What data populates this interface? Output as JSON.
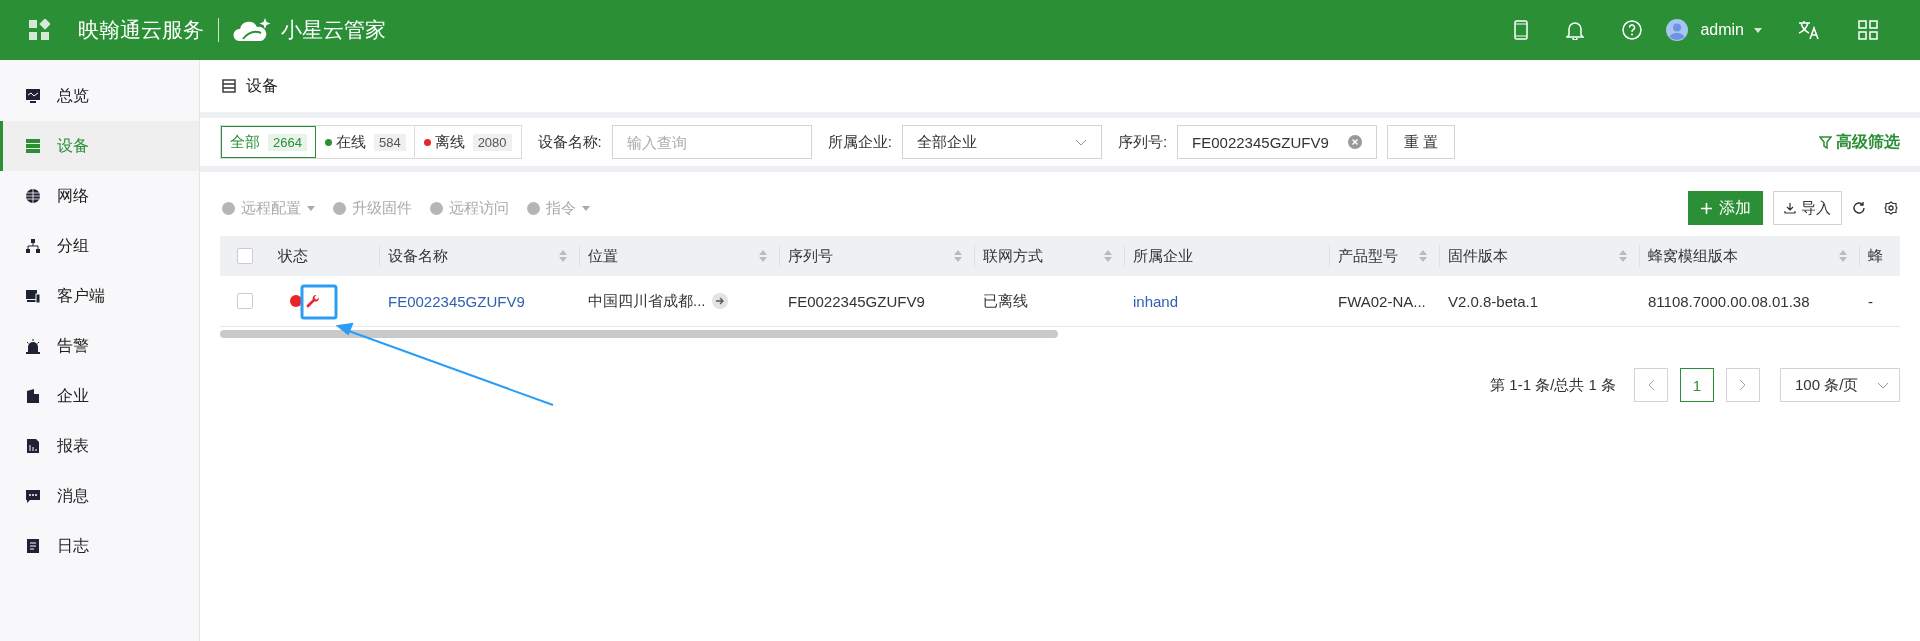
{
  "header": {
    "brand": "映翰通云服务",
    "product": "小星云管家",
    "user": "admin"
  },
  "sidebar": {
    "items": [
      {
        "label": "总览",
        "selected": false
      },
      {
        "label": "设备",
        "selected": true
      },
      {
        "label": "网络",
        "selected": false
      },
      {
        "label": "分组",
        "selected": false
      },
      {
        "label": "客户端",
        "selected": false
      },
      {
        "label": "告警",
        "selected": false
      },
      {
        "label": "企业",
        "selected": false
      },
      {
        "label": "报表",
        "selected": false
      },
      {
        "label": "消息",
        "selected": false
      },
      {
        "label": "日志",
        "selected": false
      }
    ]
  },
  "page_title": "设备",
  "filters": {
    "status_tabs": [
      {
        "label": "全部",
        "count": "2664",
        "selected": true
      },
      {
        "label": "在线",
        "count": "584",
        "selected": false,
        "color": "#2a8f35"
      },
      {
        "label": "离线",
        "count": "2080",
        "selected": false,
        "color": "#e8262a"
      }
    ],
    "name_label": "设备名称:",
    "name_placeholder": "输入查询",
    "company_label": "所属企业:",
    "company_value": "全部企业",
    "serial_label": "序列号:",
    "serial_value": "FE0022345GZUFV9",
    "reset": "重 置",
    "advanced": "高级筛选"
  },
  "toolbar": {
    "actions": [
      {
        "label": "远程配置",
        "dropdown": true,
        "disabled": true
      },
      {
        "label": "升级固件",
        "dropdown": false,
        "disabled": true
      },
      {
        "label": "远程访问",
        "dropdown": false,
        "disabled": true
      },
      {
        "label": "指令",
        "dropdown": true,
        "disabled": true
      }
    ],
    "add": "添加",
    "import": "导入"
  },
  "table": {
    "header_checked": false,
    "columns": [
      {
        "label": "状态",
        "sortable": false
      },
      {
        "label": "设备名称",
        "sortable": true
      },
      {
        "label": "位置",
        "sortable": true
      },
      {
        "label": "序列号",
        "sortable": true
      },
      {
        "label": "联网方式",
        "sortable": true
      },
      {
        "label": "所属企业",
        "sortable": false
      },
      {
        "label": "产品型号",
        "sortable": true
      },
      {
        "label": "固件版本",
        "sortable": true
      },
      {
        "label": "蜂窝模组版本",
        "sortable": true
      },
      {
        "label": "蜂",
        "sortable": false
      }
    ],
    "rows": [
      {
        "checked": false,
        "color": "#e8262a",
        "name": "FE0022345GZUFV9",
        "location": "中国四川省成都...",
        "serial": "FE0022345GZUFV9",
        "connection": "已离线",
        "company": "inhand",
        "model": "FWA02-NA...",
        "firmware": "V2.0.8-beta.1",
        "modem": "81108.7000.00.08.01.38",
        "column_10": "-"
      }
    ]
  },
  "pagination": {
    "summary": "第 1-1 条/总共 1 条",
    "pages": [
      {
        "label": "1",
        "selected": true
      }
    ],
    "page_size": "100 条/页"
  }
}
